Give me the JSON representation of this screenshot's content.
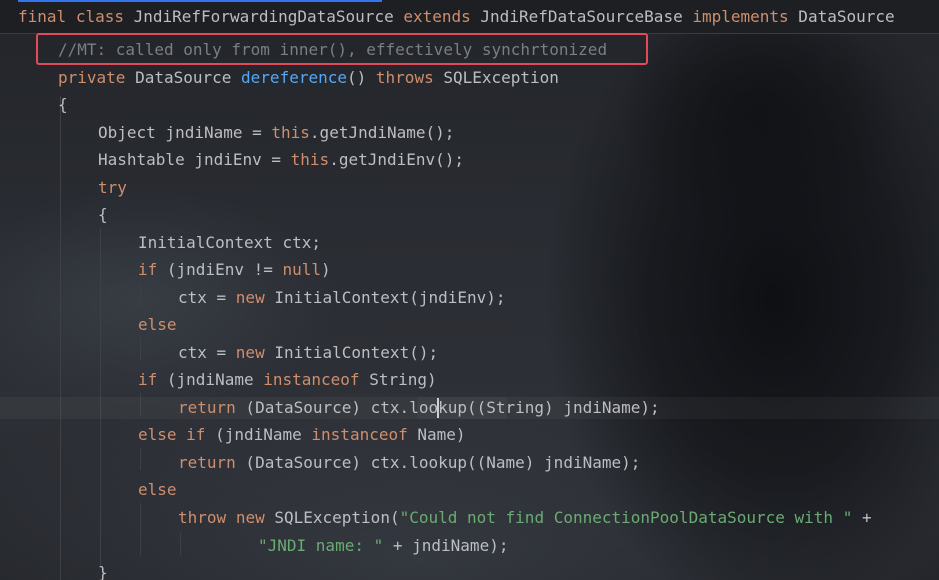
{
  "code": {
    "l1": {
      "p1": "final",
      "p2": " ",
      "p3": "class",
      "p4": " JndiRefForwardingDataSource ",
      "p5": "extends",
      "p6": " JndiRefDataSourceBase ",
      "p7": "implements",
      "p8": " DataSource"
    },
    "l2": {
      "comment": "//MT: called only from inner(), effectively synchrtonized"
    },
    "l3": {
      "p1": "private",
      "p2": " DataSource ",
      "p3": "dereference",
      "p4": "() ",
      "p5": "throws",
      "p6": " SQLException"
    },
    "l4": {
      "p1": "{"
    },
    "l5": {
      "p1": "Object jndiName = ",
      "p2": "this",
      "p3": ".getJndiName();"
    },
    "l6": {
      "p1": "Hashtable jndiEnv = ",
      "p2": "this",
      "p3": ".getJndiEnv();"
    },
    "l7": {
      "p1": "try"
    },
    "l8": {
      "p1": "{"
    },
    "l9": {
      "p1": "InitialContext ctx;"
    },
    "l10": {
      "p1": "if",
      "p2": " (jndiEnv != ",
      "p3": "null",
      "p4": ")"
    },
    "l11": {
      "p1": "ctx = ",
      "p2": "new",
      "p3": " InitialContext(jndiEnv);"
    },
    "l12": {
      "p1": "else"
    },
    "l13": {
      "p1": "ctx = ",
      "p2": "new",
      "p3": " InitialContext();"
    },
    "l14": {
      "p1": "if",
      "p2": " (jndiName ",
      "p3": "instanceof",
      "p4": " String)"
    },
    "l15": {
      "p1": "return",
      "p2": " (DataSource) ctx.lookup((String) jndiName);"
    },
    "l16": {
      "p1": "else if",
      "p2": " (jndiName ",
      "p3": "instanceof",
      "p4": " Name)"
    },
    "l17": {
      "p1": "return",
      "p2": " (DataSource) ctx.lookup((Name) jndiName);"
    },
    "l18": {
      "p1": "else"
    },
    "l19": {
      "p1": "throw",
      "p2": " ",
      "p3": "new",
      "p4": " SQLException(",
      "p5": "\"Could not find ConnectionPoolDataSource with \"",
      "p6": " +"
    },
    "l20": {
      "p1": "\"JNDI name: \"",
      "p2": " + jndiName);"
    },
    "l21": {
      "p1": "}"
    }
  },
  "colors": {
    "keyword": "#cf8e6d",
    "method": "#56a8f5",
    "string": "#6aab73",
    "comment": "#7a7e85",
    "text": "#bcbec4",
    "highlight_box": "#e04a59",
    "tab_marker": "#3574f0"
  }
}
